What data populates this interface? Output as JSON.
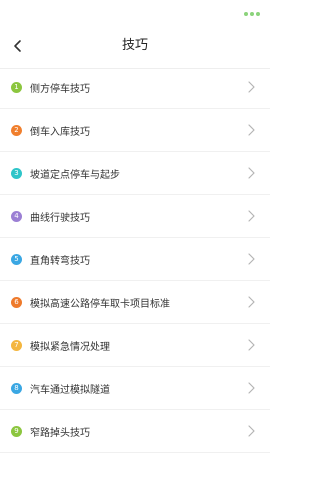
{
  "header": {
    "title": "技巧"
  },
  "status_bar": {
    "dot_colors": [
      "#8bd37b",
      "#8bd37b",
      "#8bd37b"
    ]
  },
  "items": [
    {
      "number": "1",
      "label": "侧方停车技巧",
      "color": "#8cc63f"
    },
    {
      "number": "2",
      "label": "倒车入库技巧",
      "color": "#f07f2d"
    },
    {
      "number": "3",
      "label": "坡道定点停车与起步",
      "color": "#2ec5c9"
    },
    {
      "number": "4",
      "label": "曲线行驶技巧",
      "color": "#9b7fd4"
    },
    {
      "number": "5",
      "label": "直角转弯技巧",
      "color": "#3aa7e3"
    },
    {
      "number": "6",
      "label": "模拟高速公路停车取卡项目标准",
      "color": "#ee7a2b"
    },
    {
      "number": "7",
      "label": "模拟紧急情况处理",
      "color": "#f4b63f"
    },
    {
      "number": "8",
      "label": "汽车通过模拟隧道",
      "color": "#3aa7e3"
    },
    {
      "number": "9",
      "label": "窄路掉头技巧",
      "color": "#8cc63f"
    }
  ]
}
